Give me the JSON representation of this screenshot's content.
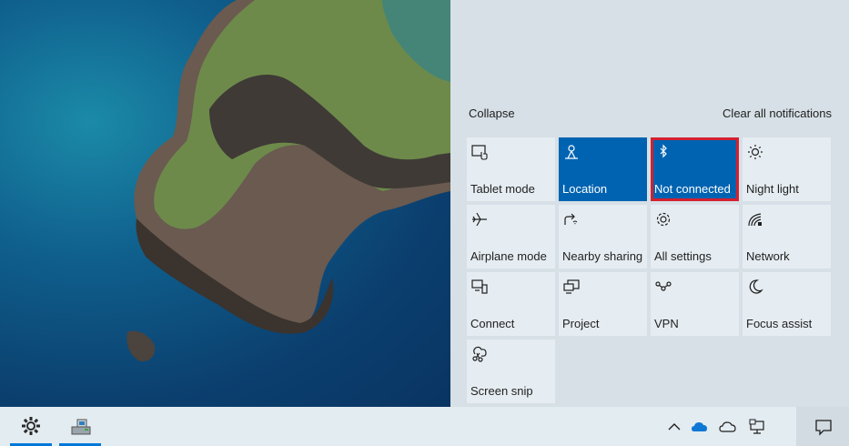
{
  "action_center": {
    "collapse_label": "Collapse",
    "clear_label": "Clear all notifications",
    "tiles": [
      {
        "label": "Tablet mode",
        "icon": "tablet-mode-icon",
        "active": false
      },
      {
        "label": "Location",
        "icon": "location-icon",
        "active": true
      },
      {
        "label": "Not connected",
        "icon": "bluetooth-icon",
        "active": true,
        "highlighted": true
      },
      {
        "label": "Night light",
        "icon": "night-light-icon",
        "active": false
      },
      {
        "label": "Airplane mode",
        "icon": "airplane-icon",
        "active": false
      },
      {
        "label": "Nearby sharing",
        "icon": "nearby-sharing-icon",
        "active": false
      },
      {
        "label": "All settings",
        "icon": "gear-icon",
        "active": false
      },
      {
        "label": "Network",
        "icon": "network-icon",
        "active": false
      },
      {
        "label": "Connect",
        "icon": "connect-icon",
        "active": false
      },
      {
        "label": "Project",
        "icon": "project-icon",
        "active": false
      },
      {
        "label": "VPN",
        "icon": "vpn-icon",
        "active": false
      },
      {
        "label": "Focus assist",
        "icon": "moon-icon",
        "active": false
      },
      {
        "label": "Screen snip",
        "icon": "screen-snip-icon",
        "active": false
      }
    ]
  },
  "taskbar": {
    "apps": [
      {
        "icon": "settings-gear-icon",
        "running": true
      },
      {
        "icon": "device-manager-icon",
        "running": true
      }
    ],
    "tray": [
      "chevron-up-icon",
      "onedrive-blue-icon",
      "onedrive-gray-icon",
      "network-monitor-icon"
    ],
    "notification_icon": "action-center-icon"
  },
  "colors": {
    "accent": "#0063b1",
    "highlight": "#d4202f",
    "panel": "#d6e0e6",
    "tile": "#e6edf2",
    "taskbar": "#e3ecf1"
  }
}
